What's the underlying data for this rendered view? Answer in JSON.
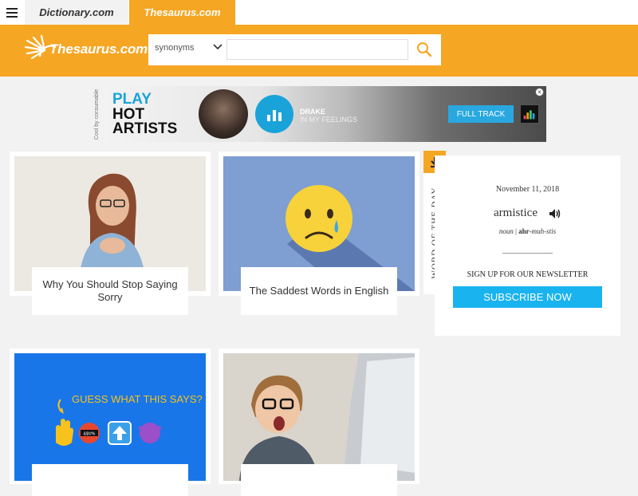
{
  "nav": {
    "tabs": [
      {
        "label": "Dictionary.com"
      },
      {
        "label": "Thesaurus.com"
      }
    ]
  },
  "header": {
    "logo_text": "Thesaurus.com",
    "search": {
      "select_value": "synonyms",
      "input_value": "",
      "input_placeholder": ""
    }
  },
  "ad": {
    "side_label": "Cool by consumable",
    "headline": [
      "PLAY",
      "HOT",
      "ARTISTS"
    ],
    "artist": "DRAKE",
    "song": "IN MY FEELINGS",
    "cta": "FULL TRACK",
    "close": "×"
  },
  "cards": [
    {
      "title": "Why You Should Stop Saying Sorry"
    },
    {
      "title": "The Saddest Words in English"
    },
    {
      "title": "",
      "image_text": "GUESS WHAT THIS SAYS?",
      "censor_text": "&$!#%"
    },
    {
      "title": ""
    }
  ],
  "word_of_the_day": {
    "heading": "WORD OF THE DAY",
    "date": "November 11, 2018",
    "word": "armistice",
    "part_of_speech": "noun",
    "pron_1": "ahr",
    "pron_2": "-muh-stis",
    "newsletter_label": "SIGN UP FOR OUR NEWSLETTER",
    "subscribe_label": "SUBSCRIBE NOW"
  },
  "colors": {
    "brand_orange": "#f5a623",
    "subscribe_blue": "#19b3f0"
  }
}
